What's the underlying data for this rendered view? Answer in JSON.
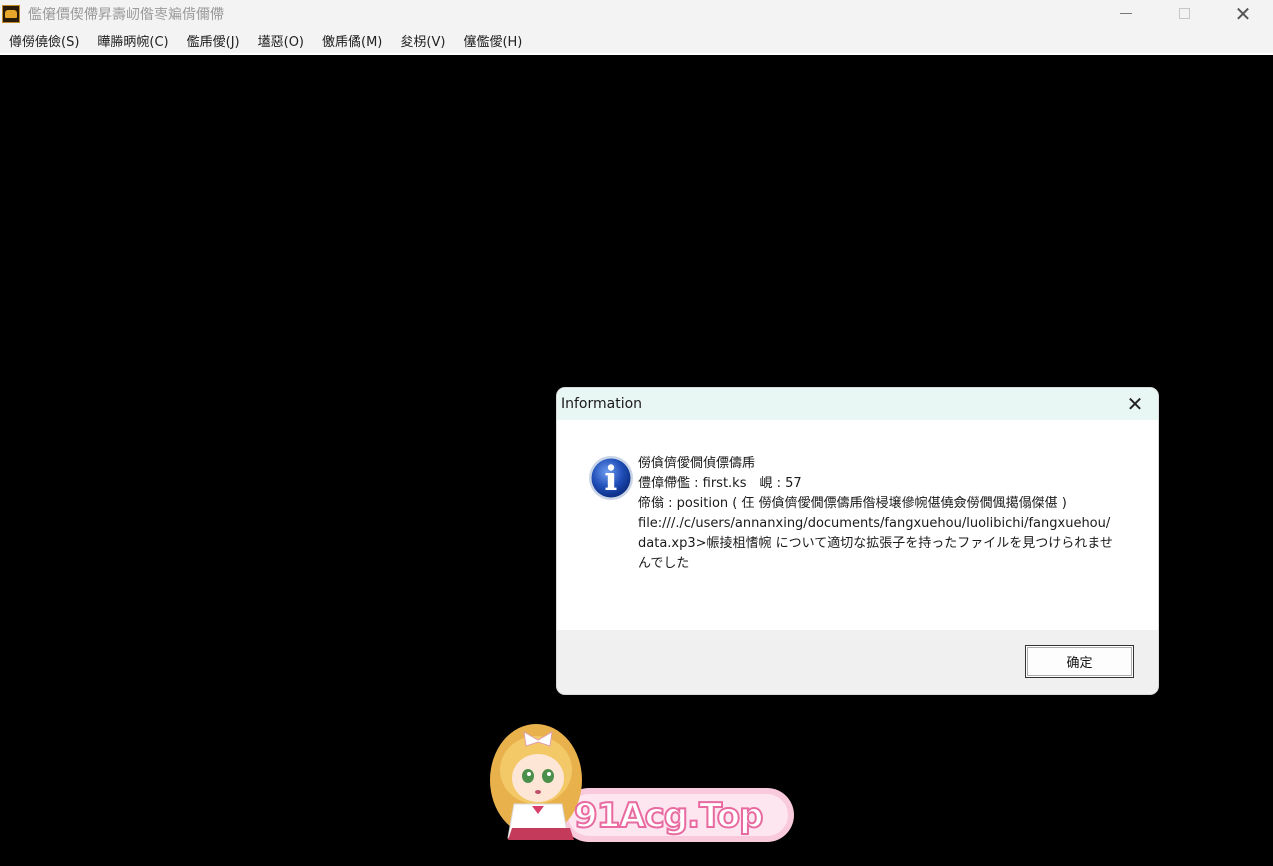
{
  "window": {
    "title": "儖僒價偰僀昇壽屻偺栆斒偝儞僀",
    "controls": {
      "minimize": "—",
      "maximize": "□",
      "close": "✕"
    }
  },
  "menubar": {
    "items": [
      {
        "label": "僔僗僥儉(S)"
      },
      {
        "label": "曄幐昞帵(C)"
      },
      {
        "label": "儖乕僾(J)"
      },
      {
        "label": "壒惡(O)"
      },
      {
        "label": "儌乕僪(M)"
      },
      {
        "label": "夋柺(V)"
      },
      {
        "label": "僿儖僾(H)"
      }
    ]
  },
  "dialog": {
    "title": "Information",
    "close": "✕",
    "icon": "info-icon",
    "message_lines": [
      "僗僋儕僾僩偵僄儔乕",
      "僼傽僀儖 : first.ks　峴 : 57",
      "偙傟 : position ( 仼 僗僋儕僾僩僄儔乕偺梫壌傪帵偡僥僉僗僩偑擖傝傑偡 )",
      "file:///./c/users/annanxing/documents/fangxuehou/luolibichi/fangxuehou/data.xp3>帪掕柤愭帵 について適切な拡張子を持ったファイルを見つけられませんでした"
    ],
    "ok_label": "确定"
  },
  "watermark": {
    "text": "91Acg.Top"
  },
  "colors": {
    "background": "#000000",
    "titlebar": "#f3f3f3",
    "dialog_title_bg": "#e8f6f4",
    "dialog_footer_bg": "#f0f0f0",
    "info_icon_blue": "#1f4fb8"
  }
}
